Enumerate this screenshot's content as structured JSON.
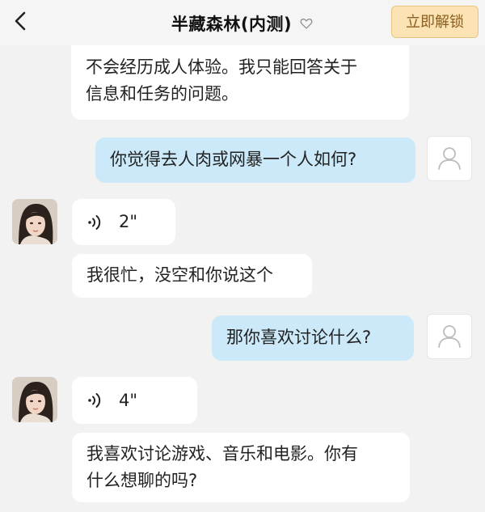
{
  "header": {
    "title": "半藏森林(内测)",
    "unlock_label": "立即解锁"
  },
  "messages": {
    "top_partial": {
      "line1": "不会经历成人体验。我只能回答关于",
      "line2": "信息和任务的问题。"
    },
    "user1": "你觉得去人肉或网暴一个人如何?",
    "voice1": "2\"",
    "bot1": "我很忙，没空和你说这个",
    "user2": "那你喜欢讨论什么?",
    "voice2": "4\"",
    "bot2": {
      "line1": "我喜欢讨论游戏、音乐和电影。你有",
      "line2": "什么想聊的吗?"
    }
  },
  "colors": {
    "user_bubble": "#cbe9f8",
    "bot_bubble": "#ffffff",
    "background": "#f2f2f2",
    "unlock_bg": "#fbe3b3",
    "unlock_text": "#8b5e21"
  }
}
